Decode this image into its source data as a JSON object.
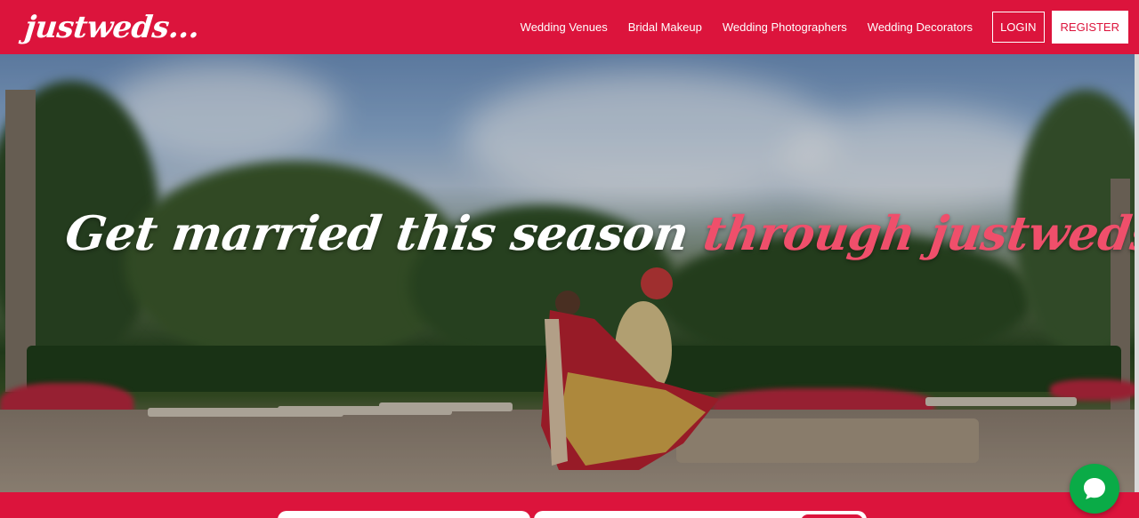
{
  "header": {
    "logo": "justweds...",
    "nav": [
      {
        "label": "Wedding Venues"
      },
      {
        "label": "Bridal Makeup"
      },
      {
        "label": "Wedding Photographers"
      },
      {
        "label": "Wedding Decorators"
      }
    ],
    "login_label": "LOGIN",
    "register_label": "REGISTER"
  },
  "hero": {
    "headline_part1": "Get married this season",
    "headline_part2": "through justweds !"
  },
  "colors": {
    "brand": "#dc143c",
    "accent_text": "#ef4f6b",
    "chat": "#0aab47"
  },
  "icons": {
    "chat": "chat-bubble-icon"
  }
}
